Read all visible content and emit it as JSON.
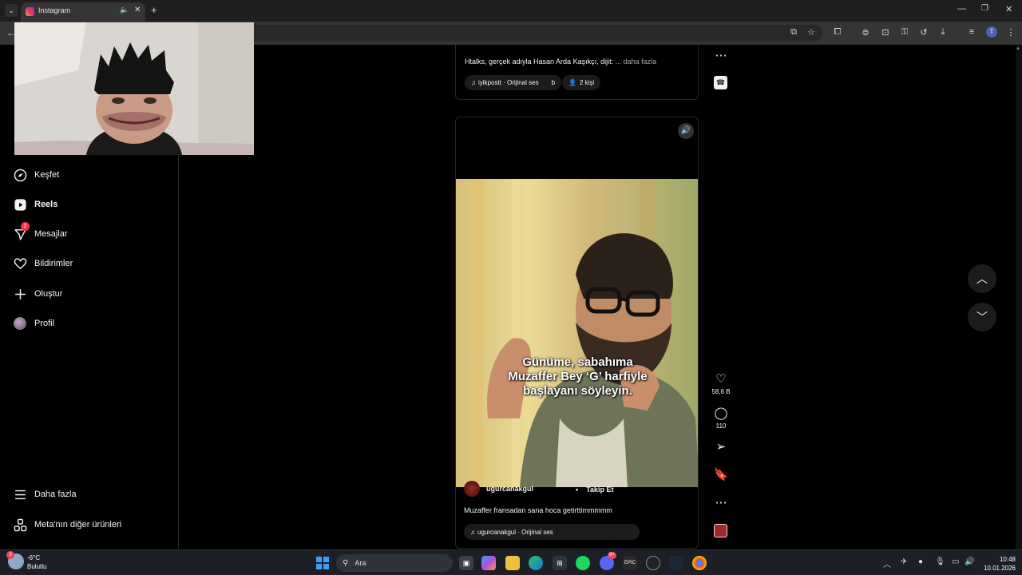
{
  "browser": {
    "tab_title": "Instagram",
    "tab_menu_icon": "chevron-down-icon",
    "new_tab": "+",
    "profile_initial": "T"
  },
  "sidebar": {
    "items": [
      {
        "label": "Keşfet",
        "icon": "compass-icon"
      },
      {
        "label": "Reels",
        "icon": "reels-icon"
      },
      {
        "label": "Mesajlar",
        "icon": "messenger-icon",
        "badge": "2"
      },
      {
        "label": "Bildirimler",
        "icon": "heart-icon"
      },
      {
        "label": "Oluştur",
        "icon": "plus-icon"
      },
      {
        "label": "Profil",
        "icon": "avatar"
      }
    ],
    "bottom": [
      {
        "label": "Daha fazla",
        "icon": "hamburger-icon"
      },
      {
        "label": "Meta'nın diğer ürünleri",
        "icon": "meta-products-icon"
      }
    ]
  },
  "post_top": {
    "caption": "Htalks, gerçek adıyla Hasan Arda Kaşıkçı, dijit:",
    "more": "... daha fazla",
    "audio": "iyikpostt · Orijinal ses",
    "chip_b": "b",
    "people": "2 kişi"
  },
  "reel": {
    "subtitle_lines": [
      "Günüme, sabahıma",
      "Muzaffer Bey ‘G’ harfiyle",
      "başlayanı söyleyin."
    ],
    "username": "ugurcanakgul",
    "follow_label": "Takip Et",
    "caption": "Muzaffer fransadan sana hoca getirttimmmmm",
    "audio": "ugurcanakgul · Orijinal ses",
    "likes": "58,6 B",
    "comments": "110"
  },
  "taskbar": {
    "weather_temp": "-6°C",
    "weather_desc": "Bulutlu",
    "weather_badge": "3",
    "search_placeholder": "Ara",
    "time": "10:48",
    "date": "10.01.2026",
    "discord_badge": "9+"
  },
  "colors": {
    "background": "#000000",
    "sidebar_border": "#262626",
    "badge": "#ff3040",
    "taskbar": "#1c1f26"
  }
}
